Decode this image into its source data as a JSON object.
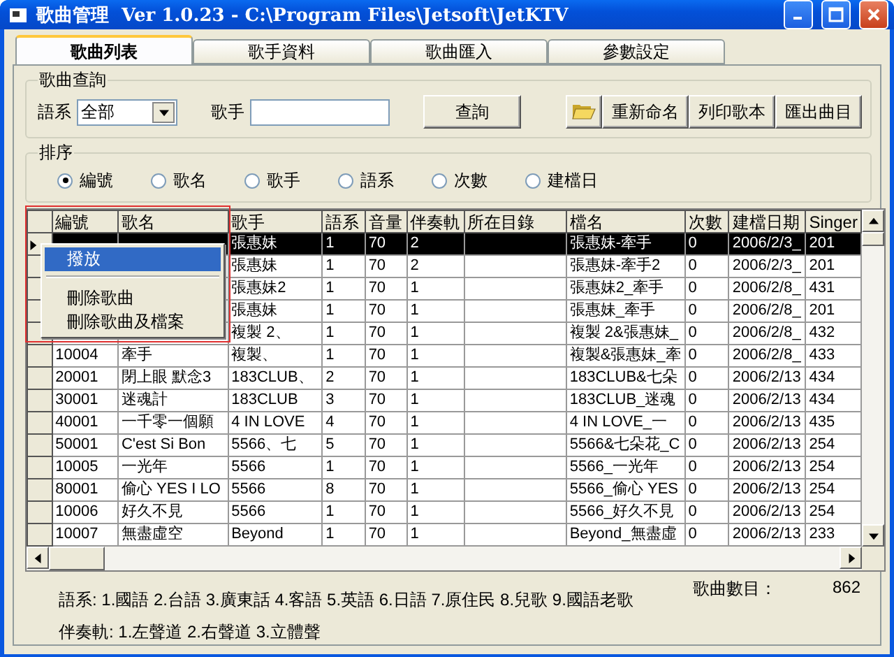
{
  "window": {
    "title": "歌曲管理  Ver 1.0.23 - C:\\Program Files\\Jetsoft\\JetKTV"
  },
  "tabs": [
    {
      "label": "歌曲列表",
      "selected": true
    },
    {
      "label": "歌手資料",
      "selected": false
    },
    {
      "label": "歌曲匯入",
      "selected": false
    },
    {
      "label": "參數設定",
      "selected": false
    }
  ],
  "query": {
    "title": "歌曲查詢",
    "language_label": "語系",
    "language_value": "全部",
    "singer_label": "歌手",
    "search_button": "查詢",
    "buttons": [
      "重新命名",
      "列印歌本",
      "匯出曲目"
    ]
  },
  "sort": {
    "title": "排序",
    "options": [
      {
        "label": "編號",
        "selected": true
      },
      {
        "label": "歌名",
        "selected": false
      },
      {
        "label": "歌手",
        "selected": false
      },
      {
        "label": "語系",
        "selected": false
      },
      {
        "label": "次數",
        "selected": false
      },
      {
        "label": "建檔日",
        "selected": false
      }
    ]
  },
  "table": {
    "columns": [
      "編號",
      "歌名",
      "歌手",
      "語系",
      "音量",
      "伴奏軌",
      "所在目錄",
      "檔名",
      "次數",
      "建檔日期",
      "Singer"
    ],
    "rows": [
      {
        "selected": true,
        "cells": [
          null,
          null,
          "張惠妹",
          "1",
          "70",
          "2",
          null,
          "張惠妹-牽手",
          "0",
          "2006/2/3_",
          "201"
        ]
      },
      {
        "selected": false,
        "cells": [
          null,
          null,
          "張惠妹",
          "1",
          "70",
          "2",
          null,
          "張惠妹-牽手2",
          "0",
          "2006/2/3_",
          "201"
        ]
      },
      {
        "selected": false,
        "cells": [
          null,
          null,
          "張惠妹2",
          "1",
          "70",
          "1",
          null,
          "張惠妹2_牽手",
          "0",
          "2006/2/8_",
          "431"
        ]
      },
      {
        "selected": false,
        "cells": [
          null,
          null,
          "張惠妹",
          "1",
          "70",
          "1",
          null,
          "張惠妹_牽手",
          "0",
          "2006/2/8_",
          "201"
        ]
      },
      {
        "selected": false,
        "cells": [
          null,
          null,
          "複製 2、",
          "1",
          "70",
          "1",
          null,
          "複製 2&張惠妹_",
          "0",
          "2006/2/8_",
          "432"
        ]
      },
      {
        "selected": false,
        "cells": [
          "10004",
          "牽手",
          "複製、",
          "1",
          "70",
          "1",
          null,
          "複製&張惠妹_牽",
          "0",
          "2006/2/8_",
          "433"
        ]
      },
      {
        "selected": false,
        "cells": [
          "20001",
          "閉上眼 默念3",
          "183CLUB、",
          "2",
          "70",
          "1",
          null,
          "183CLUB&七朵",
          "0",
          "2006/2/13",
          "434"
        ]
      },
      {
        "selected": false,
        "cells": [
          "30001",
          "迷魂計",
          "183CLUB",
          "3",
          "70",
          "1",
          null,
          "183CLUB_迷魂",
          "0",
          "2006/2/13",
          "434"
        ]
      },
      {
        "selected": false,
        "cells": [
          "40001",
          "一千零一個願",
          "4 IN LOVE",
          "4",
          "70",
          "1",
          null,
          "4 IN LOVE_一",
          "0",
          "2006/2/13",
          "435"
        ]
      },
      {
        "selected": false,
        "cells": [
          "50001",
          "C'est Si Bon",
          "5566、七",
          "5",
          "70",
          "1",
          null,
          "5566&七朵花_C",
          "0",
          "2006/2/13",
          "254"
        ]
      },
      {
        "selected": false,
        "cells": [
          "10005",
          "一光年",
          "5566",
          "1",
          "70",
          "1",
          null,
          "5566_一光年",
          "0",
          "2006/2/13",
          "254"
        ]
      },
      {
        "selected": false,
        "cells": [
          "80001",
          "偷心 YES I LO",
          "5566",
          "8",
          "70",
          "1",
          null,
          "5566_偷心 YES",
          "0",
          "2006/2/13",
          "254"
        ]
      },
      {
        "selected": false,
        "cells": [
          "10006",
          "好久不見",
          "5566",
          "1",
          "70",
          "1",
          null,
          "5566_好久不見",
          "0",
          "2006/2/13",
          "254"
        ]
      },
      {
        "selected": false,
        "cells": [
          "10007",
          "無盡虛空",
          "Beyond",
          "1",
          "70",
          "1",
          null,
          "Beyond_無盡虛",
          "0",
          "2006/2/13",
          "233"
        ]
      }
    ]
  },
  "context_menu": {
    "items": [
      {
        "label": "撥放",
        "selected": true,
        "separator_after": true
      },
      {
        "label": "刪除歌曲",
        "selected": false,
        "separator_after": false
      },
      {
        "label": "刪除歌曲及檔案",
        "selected": false,
        "separator_after": false
      }
    ]
  },
  "footer": {
    "legend_lines": [
      "語系: 1.國語 2.台語 3.廣東話 4.客語 5.英語 6.日語 7.原住民 8.兒歌 9.國語老歌",
      "伴奏軌: 1.左聲道 2.右聲道 3.立體聲"
    ],
    "count_label": "歌曲數目：",
    "count_value": "862"
  }
}
